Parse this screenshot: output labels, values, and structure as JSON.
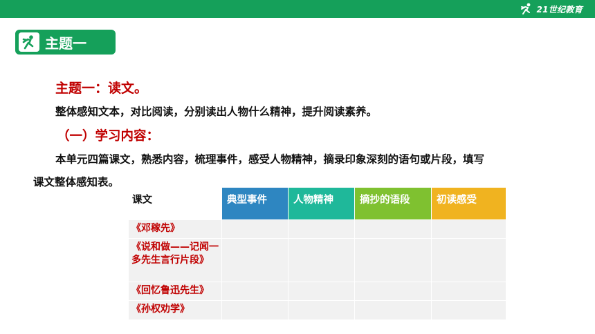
{
  "brand": {
    "name": "21世纪教育",
    "logo_icon": "runner-icon"
  },
  "topic_badge": {
    "label": "主题一",
    "icon": "runner-icon"
  },
  "heading1": "主题一：读文。",
  "line1": "整体感知文本，对比阅读，分别读出人物什么精神，提升阅读素养。",
  "heading2": "（一）学习内容：",
  "paragraph": {
    "line1": "本单元四篇课文，熟悉内容，梳理事件，感受人物精神，摘录印象深刻的语句或片段，填写",
    "line2": "课文整体感知表。"
  },
  "table": {
    "headers": [
      "课文",
      "典型事件",
      "人物精神",
      "摘抄的语段",
      "初读感受"
    ],
    "header_colors": [
      "#ffffff",
      "#2e86c1",
      "#1fb89a",
      "#7fc130",
      "#f0b320"
    ],
    "rows": [
      {
        "title": "《邓稼先》"
      },
      {
        "title": "《说和做——记闻一多先生言行片段》"
      },
      {
        "title": "《回忆鲁迅先生》"
      },
      {
        "title": "《孙权劝学》"
      }
    ]
  },
  "colors": {
    "accent_green": "#15a05a",
    "heading_red": "#c00000"
  }
}
